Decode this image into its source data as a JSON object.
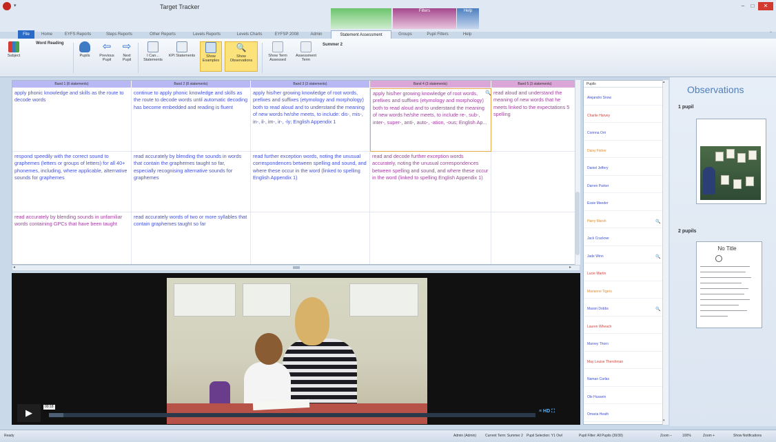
{
  "window": {
    "title": "Target Tracker",
    "context_tabs": [
      "",
      "Filters",
      "Help"
    ],
    "minimize_glyph": "–",
    "maximize_glyph": "□",
    "close_glyph": "✕"
  },
  "tabs": [
    "File",
    "Home",
    "EYFS Reports",
    "Steps Reports",
    "Other Reports",
    "Levels Reports",
    "Levels Charts",
    "EYFSP 2008",
    "Admin",
    "Statement Assessment",
    "Groups",
    "Pupil Filters",
    "Help"
  ],
  "ribbon": {
    "subject_label": "Subject",
    "subject_value": "Word Reading",
    "pupils_label": "Pupils",
    "prev_label": "Previous Pupil",
    "next_label": "Next Pupil",
    "ican_label": "I Can... Statements",
    "kpi_label": "KPI Statements",
    "examples_label": "Show Examples",
    "observations_label": "Show Observations",
    "term_assessed_label": "Show Term Assessed",
    "assessment_term_label": "Assessment Term",
    "term_value": "Summer 2"
  },
  "grid": {
    "columns": [
      {
        "header": "Band 1 (8 statements)",
        "tone": "blue"
      },
      {
        "header": "Band 2 (8 statements)",
        "tone": "blue"
      },
      {
        "header": "Band 3 (3 statements)",
        "tone": "blue"
      },
      {
        "header": "Band 4 (3 statements)",
        "tone": "pink"
      },
      {
        "header": "Band 5 (3 statements)",
        "tone": "pink"
      }
    ],
    "rows": [
      [
        {
          "text": "apply phonic knowledge and skills as the route to decode words",
          "tone": "blue"
        },
        {
          "text": "continue to apply phonic knowledge and skills as the route to decode words until automatic decoding has become embedded and reading is fluent",
          "tone": "blue"
        },
        {
          "text": "apply his/her growing knowledge of root words, prefixes and suffixes (etymology and morphology) both to read aloud and to understand the meaning of new words he/she meets, to include: dis-, mis-, in-, il-, im-, ir-, -ly; English Appendix 1",
          "tone": "blue"
        },
        {
          "text": "apply his/her growing knowledge of root words, prefixes and suffixes (etymology and morphology) both to read aloud and to understand the meaning of new words he/she meets, to include re-, sub-, inter-, super-, anti-, auto-, -ation, -ous; English Ap...",
          "tone": "pink"
        },
        {
          "text": "read aloud and understand the meaning of new words that he meets linked to the expectations 5 spelling",
          "tone": "pink"
        }
      ],
      [
        {
          "text": "respond speedily with the correct sound to graphemes (letters or groups of letters) for all 40+ phonemes, including, where applicable, alternative sounds for graphemes",
          "tone": "blue"
        },
        {
          "text": "read accurately by blending the sounds in words that contain the graphemes taught so far, especially recognising alternative sounds for graphemes",
          "tone": "blue"
        },
        {
          "text": "read further exception words, noting the unusual correspondences between spelling and sound, and where these occur in the word (linked to spelling English Appendix 1)",
          "tone": "blue"
        },
        {
          "text": "read and decode further exception words accurately, noting the unusual correspondences between spelling and sound, and where these occur in the word (linked to spelling English Appendix 1)",
          "tone": "pink"
        },
        {
          "text": "",
          "tone": "pink"
        }
      ],
      [
        {
          "text": "read accurately by blending sounds in unfamiliar words containing GPCs that have been taught",
          "tone": "pink"
        },
        {
          "text": "read accurately words of two or more syllables that contain graphemes taught so far",
          "tone": "blue"
        },
        {
          "text": "",
          "tone": "blue"
        },
        {
          "text": "",
          "tone": "pink"
        },
        {
          "text": "",
          "tone": "pink"
        }
      ]
    ],
    "magnifier_glyph": "🔍"
  },
  "video": {
    "play_glyph": "▶",
    "time_label": "00:18",
    "progress": 0.03,
    "hd_label": "HD",
    "controls_glyph": "≡ HD ⛶"
  },
  "pupils": {
    "header": "Pupils",
    "list": [
      {
        "name": "Alejandro Snow",
        "color": "blue",
        "has_observation": false
      },
      {
        "name": "Charlie Harvey",
        "color": "red",
        "has_observation": false
      },
      {
        "name": "Corinna Orri",
        "color": "blue",
        "has_observation": false
      },
      {
        "name": "Daisy Fisher",
        "color": "orange",
        "has_observation": false
      },
      {
        "name": "Daniel Jeffery",
        "color": "blue",
        "has_observation": false
      },
      {
        "name": "Darren Parker",
        "color": "blue",
        "has_observation": false
      },
      {
        "name": "Essie Meeder",
        "color": "blue",
        "has_observation": false
      },
      {
        "name": "Harry Marsh",
        "color": "orange",
        "has_observation": true
      },
      {
        "name": "Jack Crackner",
        "color": "blue",
        "has_observation": false
      },
      {
        "name": "Jade Winn",
        "color": "blue",
        "has_observation": true
      },
      {
        "name": "Lucie Martin",
        "color": "red",
        "has_observation": false
      },
      {
        "name": "Marianne Tigers",
        "color": "orange",
        "has_observation": false
      },
      {
        "name": "Mason Dobbs",
        "color": "blue",
        "has_observation": true
      },
      {
        "name": "Lauren Wheach",
        "color": "red",
        "has_observation": false
      },
      {
        "name": "Marvey Thorn",
        "color": "blue",
        "has_observation": false
      },
      {
        "name": "May Louise Thershman",
        "color": "red",
        "has_observation": false
      },
      {
        "name": "Naman Carlas",
        "color": "blue",
        "has_observation": false
      },
      {
        "name": "Ole Hussein",
        "color": "blue",
        "has_observation": false
      },
      {
        "name": "Omaria Heath",
        "color": "blue",
        "has_observation": false
      }
    ]
  },
  "observations": {
    "title": "Observations",
    "groups": [
      {
        "count_label": "1 pupil"
      },
      {
        "count_label": "2 pupils",
        "note_title": "No Title"
      }
    ]
  },
  "status": {
    "ready": "Ready",
    "user": "Admin (Admin)",
    "current_term": "Current Term: Summer 2",
    "pupil_selection": "Pupil Selection: Y1 Owl",
    "pupil_filter": "Pupil Filter: All Pupils (30/30)",
    "zoom_label": "Zoom –",
    "zoom_value": "100%",
    "zoom_plus": "Zoom +",
    "notifications": "Show Notifications"
  }
}
